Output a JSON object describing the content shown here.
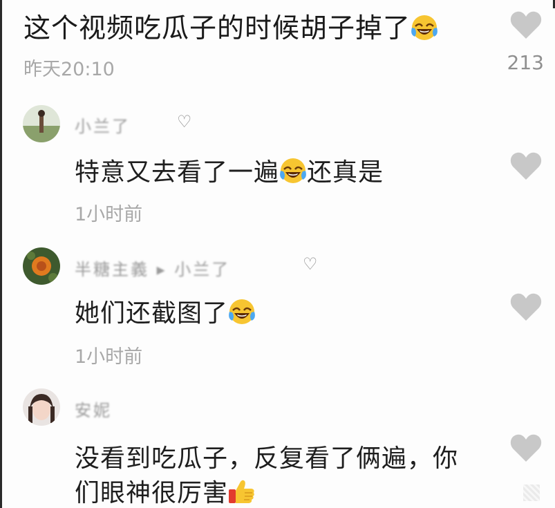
{
  "main_comment": {
    "text": "这个视频吃瓜子的时候胡子掉了",
    "emoji": "laugh-crying-emoji",
    "time": "昨天20:10",
    "likes": "213"
  },
  "replies": [
    {
      "username": "小兰了",
      "username_suffix": "♡",
      "text_before": "特意又去看了一遍",
      "emoji": "laugh-crying-emoji",
      "text_after": "还真是",
      "time": "1小时前"
    },
    {
      "username": "半糖主義 ▸ 小兰了",
      "username_suffix": "♡",
      "text_before": "她们还截图了",
      "emoji": "laugh-crying-emoji",
      "text_after": "",
      "time": "1小时前"
    },
    {
      "username": "安妮",
      "username_suffix": "",
      "text_line1": "没看到吃瓜子，反复看了俩遍，你",
      "text_line2": "们眼神很厉害",
      "emoji": "thumbs-up-emoji"
    }
  ],
  "colors": {
    "heart": "#c8c8c8",
    "meta_text": "#a8a8a8",
    "body_text": "#1e1e1e"
  }
}
